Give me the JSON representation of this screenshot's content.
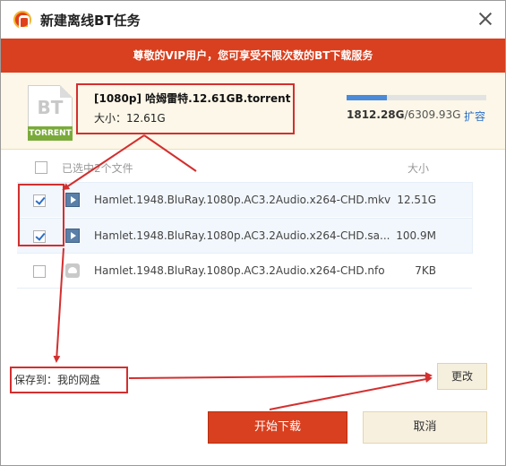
{
  "window": {
    "title": "新建离线BT任务",
    "logo_icon": "xunlei-logo-icon",
    "close_icon": "close-icon"
  },
  "banner": {
    "text": "尊敬的VIP用户，您可享受不限次数的BT下载服务"
  },
  "torrent": {
    "icon_letters": "BT",
    "icon_tag": "TORRENT",
    "filename": "[1080p] 哈姆雷特.12.61GB.torrent",
    "size_label": "大小：12.61G"
  },
  "quota": {
    "used": "1812.28G",
    "total": "/6309.93G",
    "fill_fraction": 0.287,
    "expand_label": "扩容",
    "bar_color": "#4a8ad8"
  },
  "list": {
    "header_text": "已选中2个文件",
    "header_size": "大小",
    "rows": [
      {
        "name": "Hamlet.1948.BluRay.1080p.AC3.2Audio.x264-CHD.mkv",
        "size": "12.51G",
        "checked": true,
        "icon": "video-file-icon"
      },
      {
        "name": "Hamlet.1948.BluRay.1080p.AC3.2Audio.x264-CHD.sa...",
        "size": "100.9M",
        "checked": true,
        "icon": "video-file-icon"
      },
      {
        "name": "Hamlet.1948.BluRay.1080p.AC3.2Audio.x264-CHD.nfo",
        "size": "7KB",
        "checked": false,
        "icon": "cloud-file-icon"
      }
    ]
  },
  "save": {
    "label": "保存到：我的网盘",
    "change_label": "更改"
  },
  "buttons": {
    "start_label": "开始下载",
    "cancel_label": "取消"
  },
  "colors": {
    "accent": "#d8401f",
    "annotation": "#d32f2f",
    "link": "#2a6fc9"
  }
}
